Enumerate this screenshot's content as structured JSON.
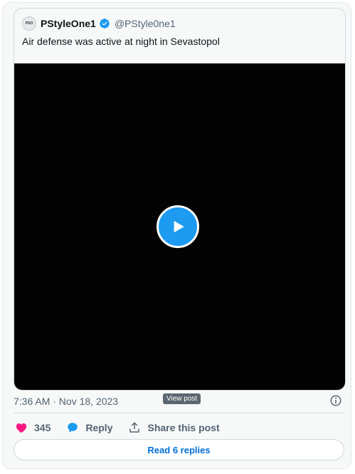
{
  "quote": {
    "avatar_text": "PSO",
    "name": "PStyleOne1",
    "handle": "@PStyle0ne1",
    "text": "Air defense was active at night in Sevastopol"
  },
  "meta": {
    "timestamp": "7:36 AM · Nov 18, 2023",
    "tooltip": "View post"
  },
  "actions": {
    "like_count": "345",
    "reply_label": "Reply",
    "share_label": "Share this post"
  },
  "read_replies_label": "Read 6 replies",
  "colors": {
    "accent": "#1d9bf0",
    "like": "#f91880",
    "link": "#006fd6"
  }
}
